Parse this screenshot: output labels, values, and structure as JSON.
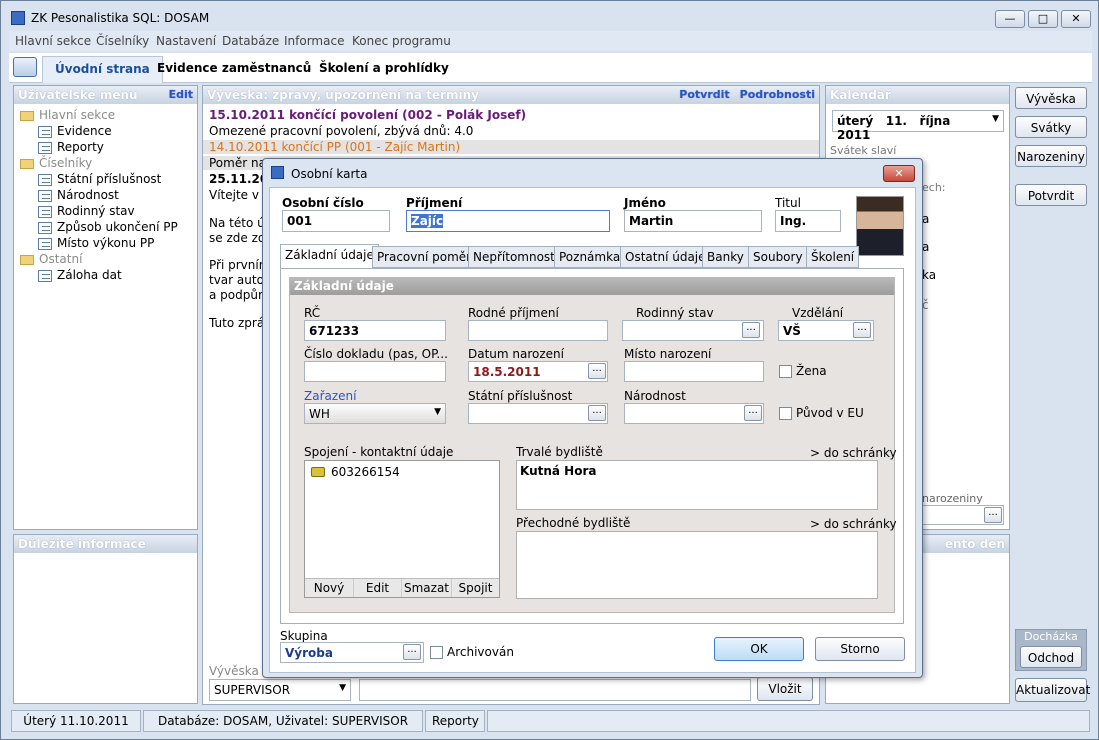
{
  "window": {
    "title": "ZK Pesonalistika SQL: DOSAM"
  },
  "menu": [
    "Hlavní sekce",
    "Číselníky",
    "Nastavení",
    "Databáze",
    "Informace",
    "Konec programu"
  ],
  "main_tabs": [
    "Úvodní strana",
    "Evidence zaměstnanců",
    "Školení a prohlídky"
  ],
  "user_menu": {
    "title": "Uživatelské menu",
    "edit": "Edit",
    "items": [
      {
        "label": "Hlavní sekce",
        "level": 0,
        "icon": "folder-icon"
      },
      {
        "label": "Evidence",
        "level": 1,
        "icon": "document-icon"
      },
      {
        "label": "Reporty",
        "level": 1,
        "icon": "document-icon"
      },
      {
        "label": "Číselníky",
        "level": 0,
        "icon": "folder-icon"
      },
      {
        "label": "Státní příslušnost",
        "level": 1,
        "icon": "document-icon"
      },
      {
        "label": "Národnost",
        "level": 1,
        "icon": "document-icon"
      },
      {
        "label": "Rodinný stav",
        "level": 1,
        "icon": "document-icon"
      },
      {
        "label": "Způsob ukončení PP",
        "level": 1,
        "icon": "document-icon"
      },
      {
        "label": "Místo výkonu PP",
        "level": 1,
        "icon": "document-icon"
      },
      {
        "label": "Ostatní",
        "level": 0,
        "icon": "folder-icon"
      },
      {
        "label": "Záloha dat",
        "level": 1,
        "icon": "document-icon"
      }
    ],
    "important_title": "Důležité informace"
  },
  "board": {
    "title": "Vývěska: zprávy, upozornění na termíny",
    "confirm": "Potvrdit",
    "details": "Podrobnosti",
    "lines": [
      {
        "text": "15.10.2011 končící povolení (002 - Polák Josef)",
        "style": "purple"
      },
      {
        "text": "Omezené pracovní povolení, zbývá dnů: 4.0",
        "style": "plain"
      },
      {
        "text": "14.10.2011 končící PP (001 - Zajíc Martin)",
        "style": "orange"
      },
      {
        "text": "Poměr na",
        "style": "plain"
      },
      {
        "text": "25.11.20",
        "style": "bold"
      },
      {
        "text": "Vítejte v",
        "style": "plain"
      },
      {
        "text": "",
        "style": "plain"
      },
      {
        "text": "Na této ú",
        "style": "plain"
      },
      {
        "text": "se zde zo",
        "style": "plain"
      },
      {
        "text": "",
        "style": "plain"
      },
      {
        "text": "Při prvním",
        "style": "plain"
      },
      {
        "text": "tvar auto",
        "style": "plain"
      },
      {
        "text": "a podpůr",
        "style": "plain"
      },
      {
        "text": "",
        "style": "plain"
      },
      {
        "text": "Tuto zprá",
        "style": "plain"
      }
    ],
    "footer_label": "Vývěska p",
    "user_select": "SUPERVISOR",
    "post_button": "Vložit"
  },
  "calendar": {
    "title": "Kalendář",
    "day": "úterý",
    "date": "11.",
    "month": "října",
    "year": "2011",
    "holiday_label": "Svátek slaví",
    "fragment_1": "ech:",
    "fragment_2": "a",
    "fragment_3": "a",
    "fragment_4": "ka",
    "fragment_5": "č",
    "birthdays_label": "narozeniny",
    "today_head": "ento den"
  },
  "right_buttons": [
    "Vývěska",
    "Svátky",
    "Narozeniny",
    "Potvrdit"
  ],
  "attendance": {
    "title": "Docházka",
    "leave": "Odchod"
  },
  "refresh_button": "Aktualizovat",
  "dialog": {
    "title": "Osobní karta",
    "personal_number_label": "Osobní číslo",
    "personal_number": "001",
    "surname_label": "Příjmení",
    "surname": "Zajíc",
    "name_label": "Jméno",
    "name": "Martin",
    "title_label": "Titul",
    "title_value": "Ing.",
    "tabs": [
      "Základní údaje",
      "Pracovní poměr",
      "Nepřítomnost",
      "Poznámka",
      "Ostatní údaje",
      "Banky",
      "Soubory",
      "Školení"
    ],
    "section_title": "Základní údaje",
    "fields": {
      "rc_label": "RČ",
      "rc": "671233",
      "birth_surname_label": "Rodné příjmení",
      "birth_surname": "",
      "marital_label": "Rodinný stav",
      "marital": "",
      "education_label": "Vzdělání",
      "education": "VŠ",
      "doc_label": "Číslo dokladu (pas, OP...",
      "doc": "",
      "birth_date_label": "Datum narození",
      "birth_date": "18.5.2011",
      "birth_place_label": "Místo narození",
      "birth_place": "",
      "woman_label": "Žena",
      "assignment_label": "Zařazení",
      "assignment": "WH",
      "citizenship_label": "Státní příslušnost",
      "citizenship": "",
      "nationality_label": "Národnost",
      "nationality": "",
      "eu_label": "Původ v EU"
    },
    "contacts": {
      "label": "Spojení -  kontaktní údaje",
      "items": [
        "603266154"
      ],
      "buttons": [
        "Nový",
        "Edit",
        "Smazat",
        "Spojit"
      ]
    },
    "permanent_label": "Trvalé bydliště",
    "permanent_link": "> do schránky",
    "permanent_value": "Kutná Hora",
    "temporary_label": "Přechodné bydliště",
    "temporary_link": "> do schránky",
    "temporary_value": "",
    "group_label": "Skupina",
    "group_value": "Výroba",
    "archived_label": "Archivován",
    "ok": "OK",
    "cancel": "Storno"
  },
  "status": {
    "date": "Úterý 11.10.2011",
    "db": "Databáze: DOSAM, Uživatel: SUPERVISOR",
    "section": "Reporty"
  },
  "colors": {
    "accent": "#1b4f9c",
    "purple": "#6a1b7a",
    "orange": "#d9751a",
    "link": "#2a55c8"
  }
}
